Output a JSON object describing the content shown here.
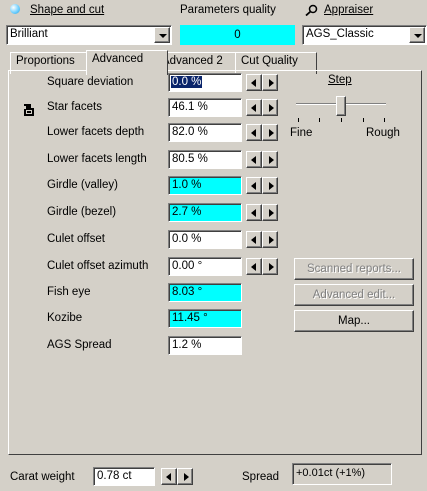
{
  "header": {
    "shape_label": "Shape and cut",
    "params_label": "Parameters quality",
    "appraiser_label": "Appraiser",
    "shape_value": "Brilliant",
    "quality_value": "0",
    "appraiser_value": "AGS_Classic"
  },
  "tabs": [
    "Proportions",
    "Advanced",
    "Advanced 2",
    "Cut Quality"
  ],
  "params": [
    {
      "label": "Square deviation",
      "value": "0.0 %"
    },
    {
      "label": "Star facets",
      "value": "46.1 %"
    },
    {
      "label": "Lower facets depth",
      "value": "82.0 %"
    },
    {
      "label": "Lower facets length",
      "value": "80.5 %"
    },
    {
      "label": "Girdle (valley)",
      "value": "1.0 %"
    },
    {
      "label": "Girdle (bezel)",
      "value": "2.7 %"
    },
    {
      "label": "Culet offset",
      "value": "0.0 %"
    },
    {
      "label": "Culet offset azimuth",
      "value": "0.00 °"
    },
    {
      "label": "Fish eye",
      "value": "8.03 °"
    },
    {
      "label": "Kozibe",
      "value": "11.45 °"
    },
    {
      "label": "AGS Spread",
      "value": "1.2 %"
    }
  ],
  "step": {
    "label": "Step",
    "fine": "Fine",
    "rough": "Rough"
  },
  "buttons": {
    "scanned": "Scanned reports...",
    "advanced_edit": "Advanced edit...",
    "map": "Map..."
  },
  "footer": {
    "carat_label": "Carat weight",
    "carat_value": "0.78 ct",
    "spread_label": "Spread",
    "spread_value": "+0.01ct (+1%)"
  },
  "colors": {
    "highlight": "#00ffff",
    "face": "#d4d0c8",
    "selection": "#0a246a"
  }
}
